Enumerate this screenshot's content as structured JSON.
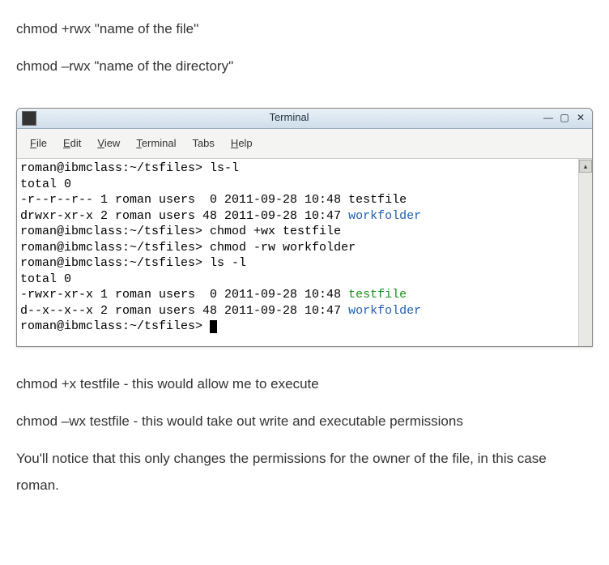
{
  "doc": {
    "line1": "chmod +rwx \"name of the file\"",
    "line2": "chmod –rwx \"name of the directory\"",
    "line3": "chmod +x testfile - this would allow me to execute",
    "line4": "chmod –wx testfile - this would take out write and executable permissions",
    "line5": "You'll notice that this only changes the permissions for the owner of the file, in this case roman."
  },
  "terminal": {
    "title": "Terminal",
    "menus": {
      "file": {
        "pre": "F",
        "rest": "ile"
      },
      "edit": {
        "pre": "E",
        "rest": "dit"
      },
      "view": {
        "pre": "V",
        "rest": "iew"
      },
      "terminal": {
        "pre": "T",
        "rest": "erminal"
      },
      "tabs": {
        "pre": "T",
        "rest": "abs"
      },
      "help": {
        "pre": "H",
        "rest": "elp"
      }
    },
    "controls": {
      "min": "—",
      "max": "▢",
      "close": "✕"
    },
    "scroll": {
      "up": "▴",
      "down": "▾"
    },
    "lines": {
      "l0": "roman@ibmclass:~/tsfiles> ls-l",
      "l1": "total 0",
      "l2a": "-r--r--r-- 1 roman users  0 2011-09-28 10:48 ",
      "l2b": "testfile",
      "l3a": "drwxr-xr-x 2 roman users 48 2011-09-28 10:47 ",
      "l3b": "workfolder",
      "l4": "roman@ibmclass:~/tsfiles> chmod +wx testfile",
      "l5": "roman@ibmclass:~/tsfiles> chmod -rw workfolder",
      "l6": "roman@ibmclass:~/tsfiles> ls -l",
      "l7": "total 0",
      "l8a": "-rwxr-xr-x 1 roman users  0 2011-09-28 10:48 ",
      "l8b": "testfile",
      "l9a": "d--x--x--x 2 roman users 48 2011-09-28 10:47 ",
      "l9b": "workfolder",
      "l10": "roman@ibmclass:~/tsfiles> "
    }
  }
}
